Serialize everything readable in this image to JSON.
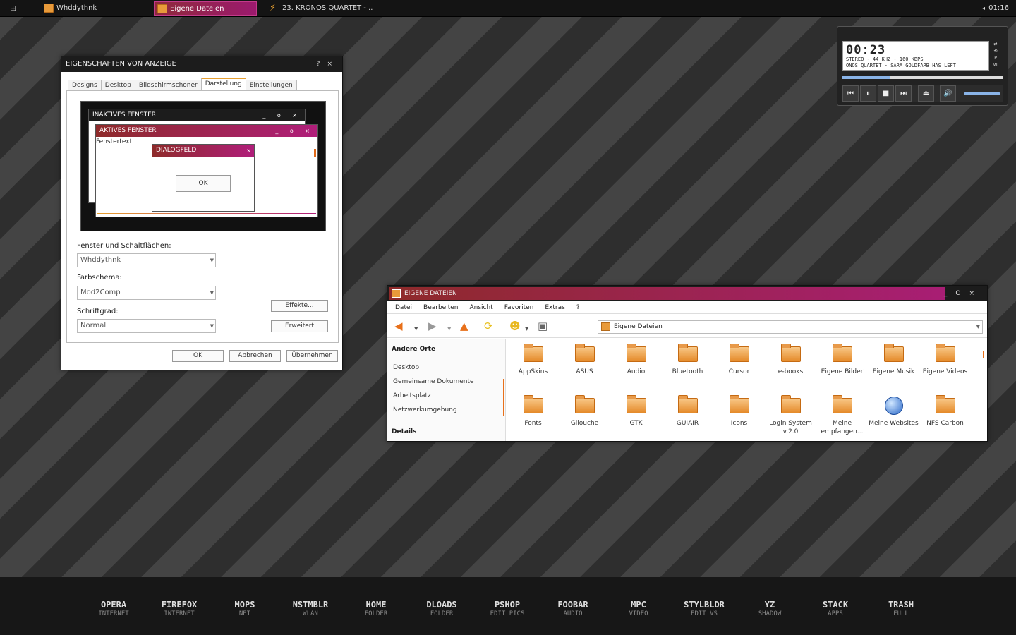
{
  "taskbar": {
    "tasks": [
      {
        "label": "Whddythnk"
      },
      {
        "label": "Eigene Dateien"
      },
      {
        "label": "23. KRONOS QUARTET - ..."
      }
    ],
    "tray": "◂",
    "clock": "01:16"
  },
  "display_props": {
    "title": "EIGENSCHAFTEN VON ANZEIGE",
    "help": "?",
    "close": "×",
    "tabs": [
      "Designs",
      "Desktop",
      "Bildschirmschoner",
      "Darstellung",
      "Einstellungen"
    ],
    "preview": {
      "inactive": "INAKTIVES FENSTER",
      "active": "AKTIVES FENSTER",
      "window_text": "Fenstertext",
      "dialog": "DIALOGFELD",
      "ok": "OK"
    },
    "windows_label": "Fenster und Schaltflächen:",
    "windows_value": "Whddythnk",
    "scheme_label": "Farbschema:",
    "scheme_value": "Mod2Comp",
    "font_label": "Schriftgrad:",
    "font_value": "Normal",
    "effects": "Effekte...",
    "advanced": "Erweitert",
    "ok": "OK",
    "cancel": "Abbrechen",
    "apply": "Übernehmen"
  },
  "explorer": {
    "title": "EIGENE DATEIEN",
    "menu": [
      "Datei",
      "Bearbeiten",
      "Ansicht",
      "Favoriten",
      "Extras",
      "?"
    ],
    "address": "Eigene Dateien",
    "left": {
      "header": "Andere Orte",
      "items": [
        "Desktop",
        "Gemeinsame Dokumente",
        "Arbeitsplatz",
        "Netzwerkumgebung"
      ],
      "details": "Details"
    },
    "items": [
      "AppSkins",
      "ASUS",
      "Audio",
      "Bluetooth",
      "Cursor",
      "e-books",
      "Eigene Bilder",
      "Eigene Musik",
      "Eigene Videos",
      "Fonts",
      "Gilouche",
      "GTK",
      "GUIAIR",
      "Icons",
      "Login System v.2.0",
      "Meine empfangen...",
      "Meine Websites",
      "NFS Carbon"
    ]
  },
  "player": {
    "time": "00:23",
    "line1": "STEREO - 44 KHZ - 160 KBPS",
    "line2": "ONOS QUARTET - SARA GOLDFARB HAS LEFT",
    "side": [
      "⇄",
      "⟲",
      "P",
      "ML"
    ],
    "progress": 0.3
  },
  "dock": [
    {
      "n": "OPERA",
      "s": "INTERNET"
    },
    {
      "n": "FIREFOX",
      "s": "INTERNET"
    },
    {
      "n": "MOPS",
      "s": "NET"
    },
    {
      "n": "NSTMBLR",
      "s": "WLAN"
    },
    {
      "n": "HOME",
      "s": "FOLDER"
    },
    {
      "n": "DLOADS",
      "s": "FOLDER"
    },
    {
      "n": "PSHOP",
      "s": "EDIT PICS"
    },
    {
      "n": "FOOBAR",
      "s": "AUDIO"
    },
    {
      "n": "MPC",
      "s": "VIDEO"
    },
    {
      "n": "STYLBLDR",
      "s": "EDIT VS"
    },
    {
      "n": "YZ",
      "s": "SHADOW"
    },
    {
      "n": "STACK",
      "s": "APPS"
    },
    {
      "n": "TRASH",
      "s": "FULL"
    }
  ]
}
